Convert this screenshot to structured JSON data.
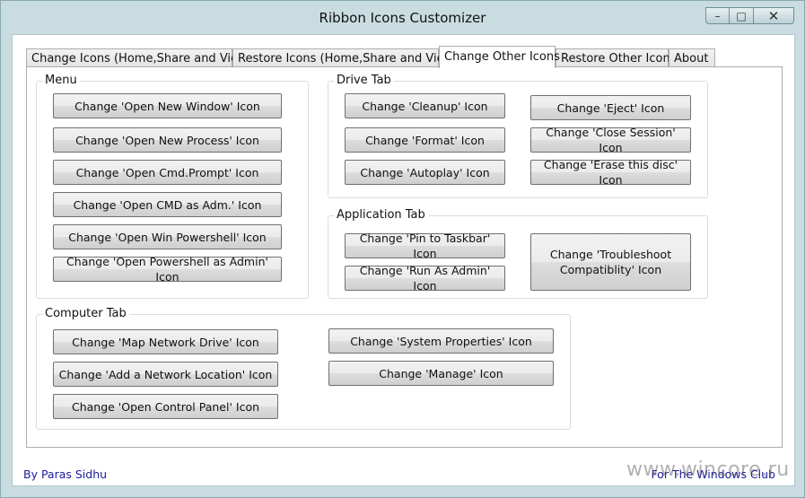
{
  "window": {
    "title": "Ribbon Icons Customizer",
    "minimize_glyph": "–",
    "maximize_glyph": "□",
    "close_glyph": "✕"
  },
  "tabs": [
    {
      "label": "Change Icons (Home,Share and View)"
    },
    {
      "label": "Restore Icons (Home,Share and View)"
    },
    {
      "label": "Change Other Icons",
      "active": true
    },
    {
      "label": "Restore Other Icons"
    },
    {
      "label": "About"
    }
  ],
  "groups": {
    "menu": {
      "label": "Menu",
      "buttons": [
        "Change 'Open New Window' Icon",
        "Change 'Open New Process' Icon",
        "Change 'Open Cmd.Prompt' Icon",
        "Change 'Open CMD as Adm.' Icon",
        "Change 'Open Win Powershell' Icon",
        "Change 'Open Powershell as Admin' Icon"
      ]
    },
    "drive": {
      "label": "Drive Tab",
      "buttons": [
        "Change 'Cleanup' Icon",
        "Change 'Eject' Icon",
        "Change 'Format' Icon",
        "Change 'Close Session' Icon",
        "Change 'Autoplay' Icon",
        "Change 'Erase this disc' Icon"
      ]
    },
    "application": {
      "label": "Application Tab",
      "buttons": [
        "Change 'Pin to Taskbar' Icon",
        "Change 'Run As Admin' Icon",
        "Change 'Troubleshoot Compatiblity' Icon"
      ]
    },
    "computer": {
      "label": "Computer Tab",
      "buttons": [
        "Change 'Map Network Drive' Icon",
        "Change 'System Properties' Icon",
        "Change 'Add a Network Location' Icon",
        "Change 'Manage' Icon",
        "Change 'Open Control Panel' Icon"
      ]
    }
  },
  "footer": {
    "author": "By Paras Sidhu",
    "credit": "For The Windows Club"
  },
  "watermark": "www.wincore.ru"
}
